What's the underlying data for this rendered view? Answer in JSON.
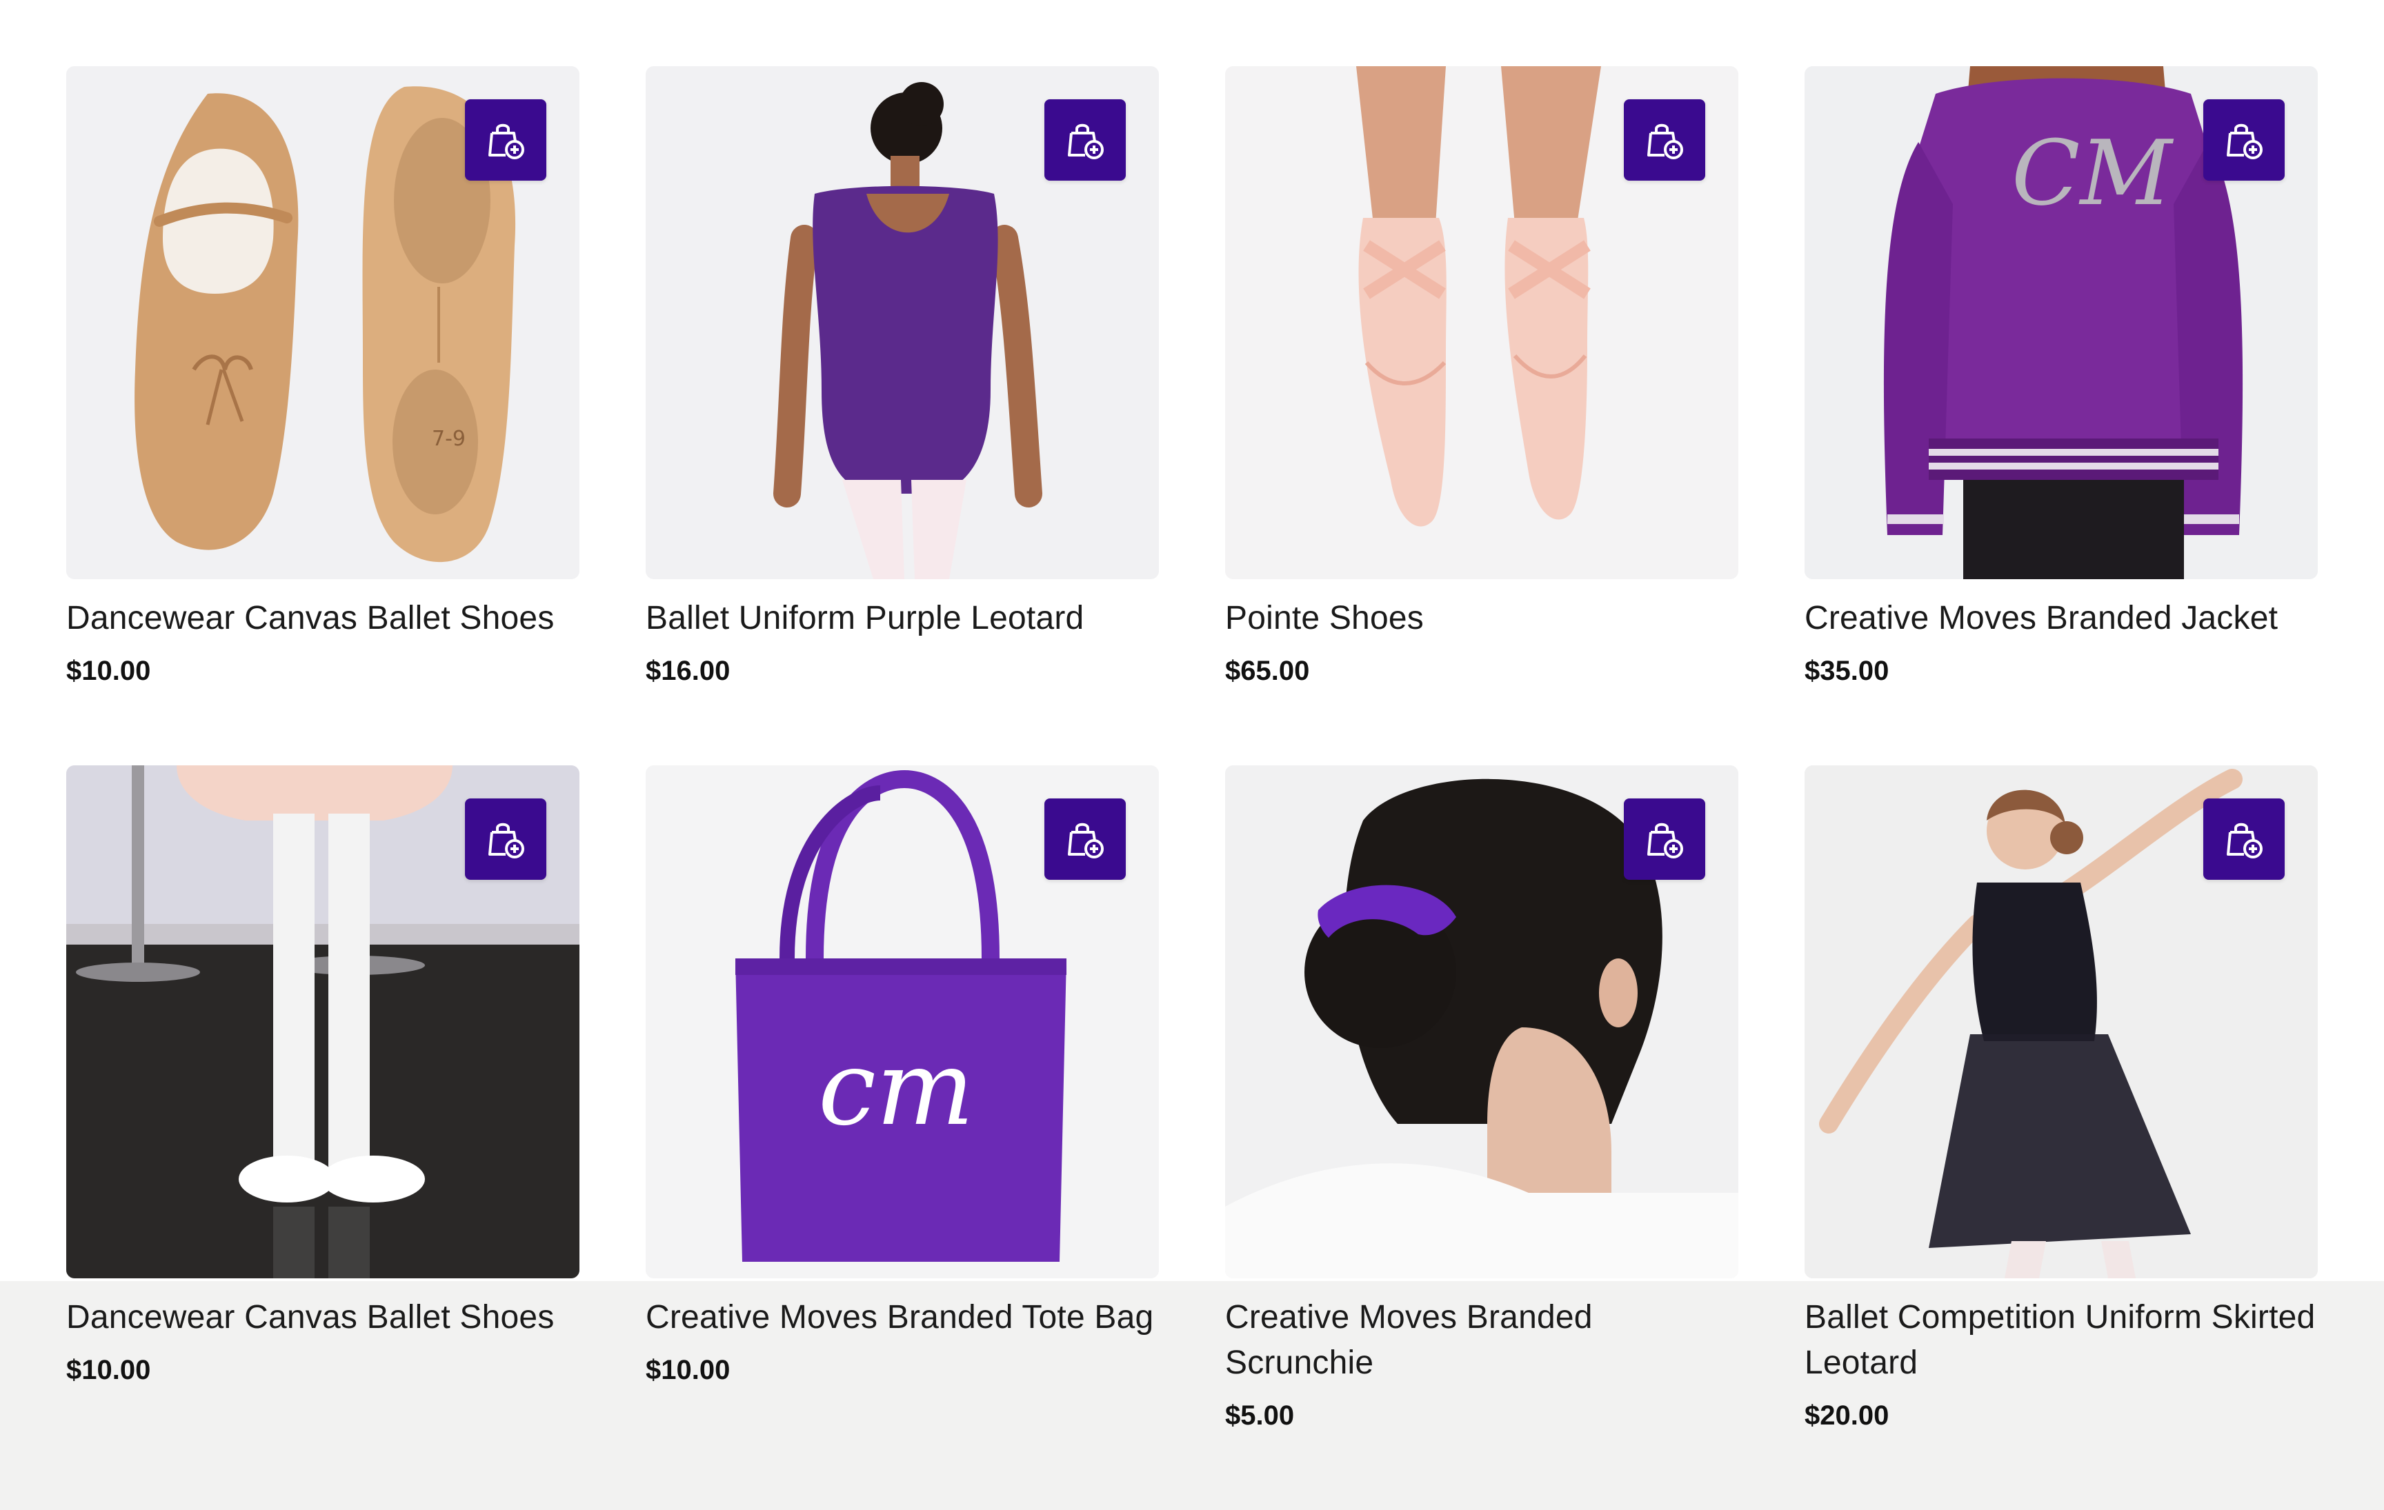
{
  "products": [
    {
      "name": "Dancewear Canvas Ballet Shoes",
      "price": "$10.00",
      "image_label": "7-9",
      "add_icon": "shopping-bag-plus-icon"
    },
    {
      "name": "Ballet Uniform Purple Leotard",
      "price": "$16.00",
      "add_icon": "shopping-bag-plus-icon"
    },
    {
      "name": "Pointe Shoes",
      "price": "$65.00",
      "add_icon": "shopping-bag-plus-icon"
    },
    {
      "name": "Creative Moves Branded Jacket",
      "price": "$35.00",
      "image_label": "CM",
      "add_icon": "shopping-bag-plus-icon"
    },
    {
      "name": "Dancewear Canvas Ballet Shoes",
      "price": "$10.00",
      "add_icon": "shopping-bag-plus-icon"
    },
    {
      "name": "Creative Moves Branded Tote Bag",
      "price": "$10.00",
      "image_label": "cm",
      "add_icon": "shopping-bag-plus-icon"
    },
    {
      "name": "Creative Moves Branded Scrunchie",
      "price": "$5.00",
      "add_icon": "shopping-bag-plus-icon"
    },
    {
      "name": "Ballet Competition Uniform Skirted Leotard",
      "price": "$20.00",
      "add_icon": "shopping-bag-plus-icon"
    }
  ],
  "colors": {
    "accent": "#3a0a8f",
    "purple_product": "#6b2ab5",
    "bottom_band": "#f2f2f1"
  }
}
